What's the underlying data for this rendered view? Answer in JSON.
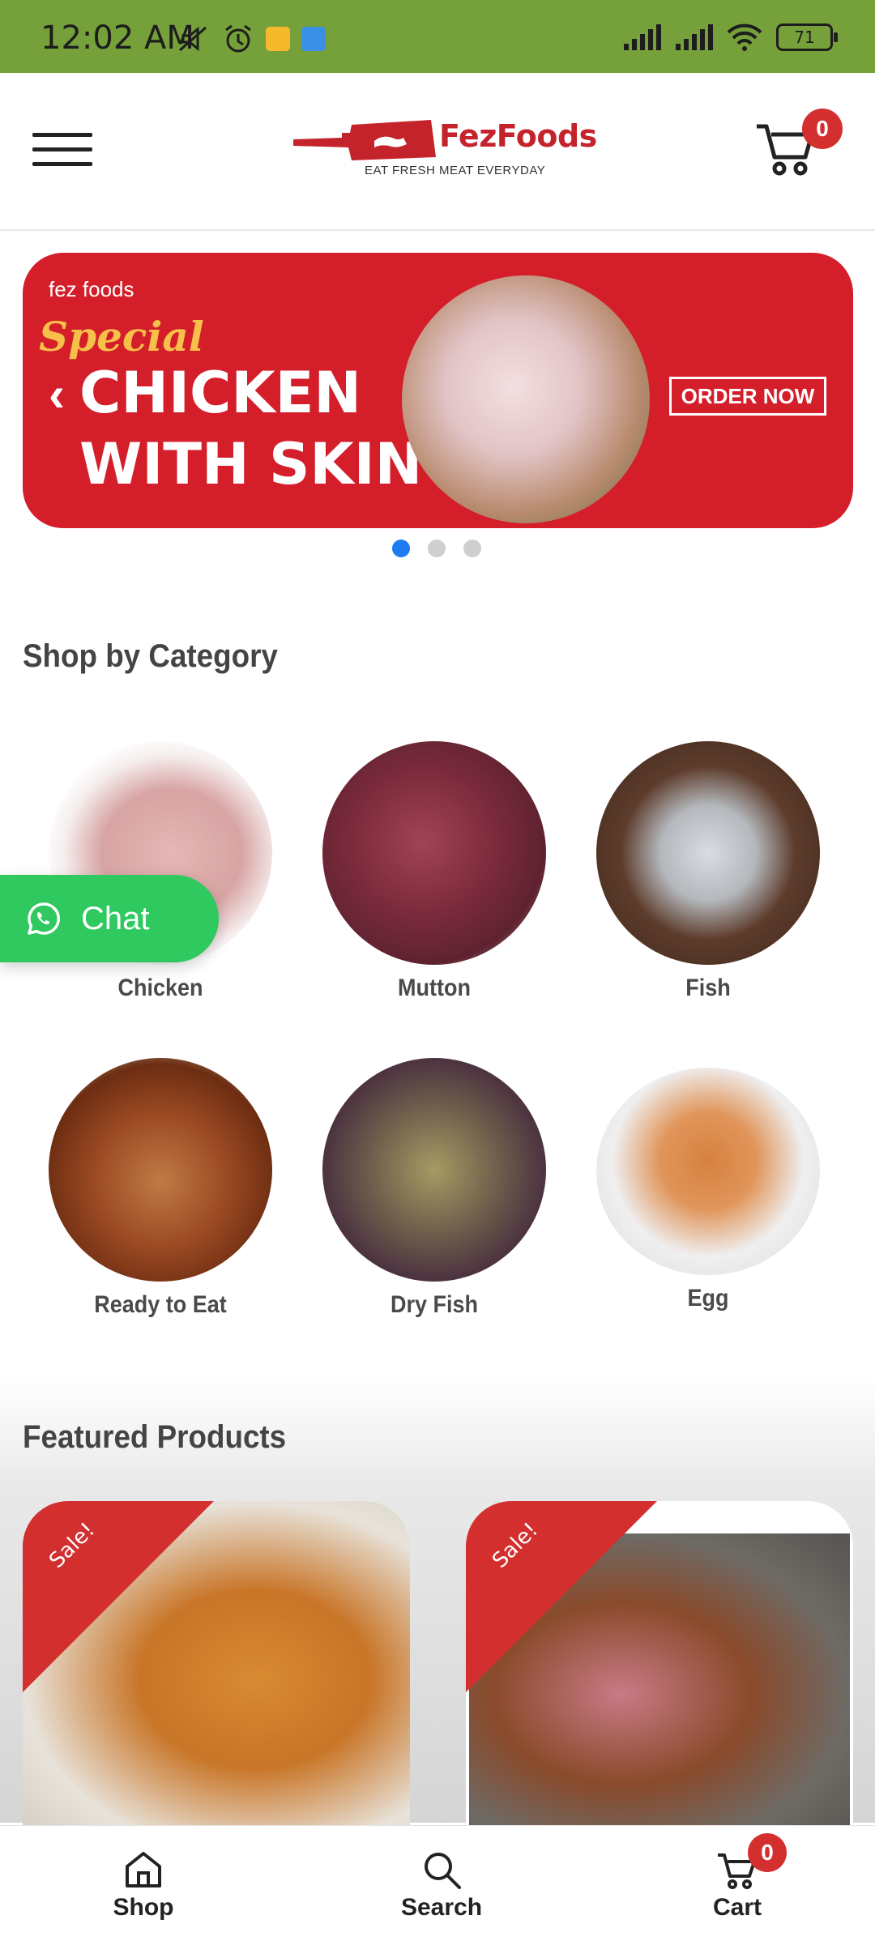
{
  "status_bar": {
    "time": "12:02 AM",
    "battery": "71",
    "icons": [
      "mute-icon",
      "alarm-icon",
      "notification-app-icon",
      "notification-app2-icon",
      "signal-icon",
      "signal2-icon",
      "wifi-icon",
      "battery-icon"
    ]
  },
  "header": {
    "logo_name": "FezFoods",
    "logo_tagline": "EAT FRESH MEAT EVERYDAY",
    "cart_count": "0"
  },
  "banner": {
    "brand": "fez foods",
    "special": "Special",
    "line1": "CHICKEN",
    "line2": "WITH SKIN",
    "cta": "ORDER NOW",
    "prev_arrow": "‹",
    "active_slide": 1,
    "total_slides": 3
  },
  "categories": {
    "title": "Shop by Category",
    "items": [
      {
        "label": "Chicken"
      },
      {
        "label": "Mutton"
      },
      {
        "label": "Fish"
      },
      {
        "label": "Ready to Eat"
      },
      {
        "label": "Dry Fish"
      },
      {
        "label": "Egg"
      }
    ]
  },
  "chat": {
    "label": "Chat"
  },
  "featured": {
    "title": "Featured Products",
    "products": [
      {
        "badge": "Sale!"
      },
      {
        "badge": "Sale!"
      }
    ]
  },
  "bottom_nav": {
    "items": [
      {
        "label": "Shop",
        "icon": "home-icon"
      },
      {
        "label": "Search",
        "icon": "search-icon"
      },
      {
        "label": "Cart",
        "icon": "cart-icon"
      }
    ],
    "cart_count": "0"
  },
  "colors": {
    "status_bar": "#76a13a",
    "brand_red": "#d41f2b",
    "chat_green": "#2fc960",
    "active_dot": "#1e7cf0"
  }
}
